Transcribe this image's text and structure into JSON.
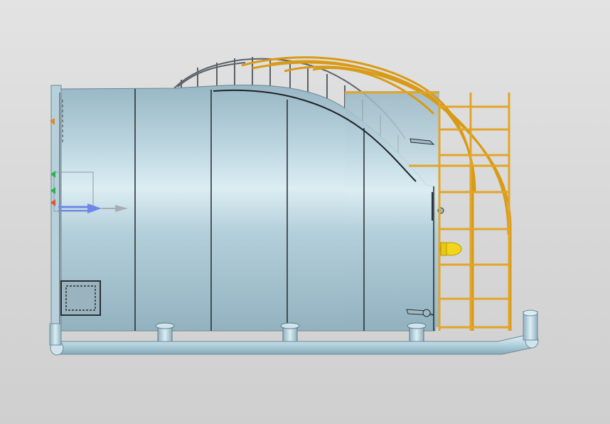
{
  "viewport": {
    "background_top": "#e3e3e3",
    "background_bottom": "#cfcfcf"
  },
  "model": {
    "tank_body_color": "#a9c6d3",
    "tank_highlight_color": "#d9ecf2",
    "tank_seam_color": "#2b2f33",
    "ladder_color": "#e3a72a",
    "ladder_dark_color": "#b97f12",
    "pipe_color": "#bcd8e4",
    "valve_color": "#f2d21a"
  },
  "triad": {
    "x_axis_color": "#6f88e8",
    "y_axis_color": "#2fb14f",
    "z_axis_color": "#e0562d"
  }
}
